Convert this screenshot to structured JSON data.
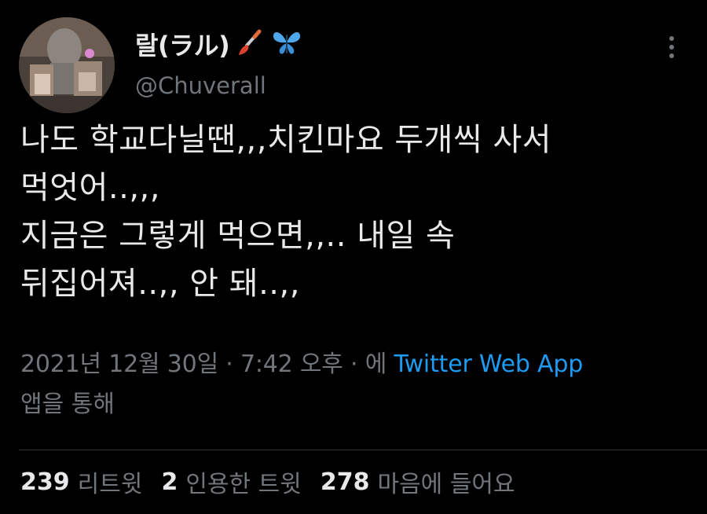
{
  "author": {
    "display_name": "랄(ラル)",
    "name_emojis": [
      "paintbrush-emoji",
      "butterfly-emoji"
    ],
    "handle": "@Chuverall"
  },
  "tweet": {
    "lines": [
      "나도 학교다닐땐,,,치킨마요 두개씩 사서",
      "먹엇어..,,,",
      "지금은 그렇게 먹으면,,.. 내일 속",
      "뒤집어져..,, 안 돼..,,"
    ]
  },
  "meta": {
    "timestamp": "2021년 12월 30일 · 7:42 오후 · 에 ",
    "source": "Twitter Web App",
    "source_suffix": "앱을 통해"
  },
  "stats": {
    "retweets_count": "239",
    "retweets_label": "리트윗",
    "quotes_count": "2",
    "quotes_label": "인용한 트윗",
    "likes_count": "278",
    "likes_label": "마음에 들어요"
  },
  "colors": {
    "background": "#000000",
    "text_primary": "#e7e9ea",
    "text_secondary": "#71767b",
    "link": "#1d9bf0"
  }
}
